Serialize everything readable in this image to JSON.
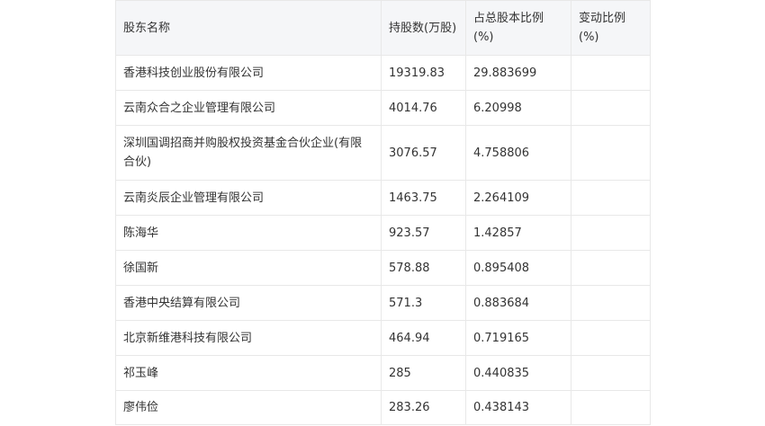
{
  "table": {
    "headers": [
      "股东名称",
      "持股数(万股)",
      "占总股本比例(%)",
      "变动比例(%)"
    ],
    "rows": [
      [
        "香港科技创业股份有限公司",
        "19319.83",
        "29.883699",
        ""
      ],
      [
        "云南众合之企业管理有限公司",
        "4014.76",
        "6.20998",
        ""
      ],
      [
        "深圳国调招商并购股权投资基金合伙企业(有限合伙)",
        "3076.57",
        "4.758806",
        ""
      ],
      [
        "云南炎辰企业管理有限公司",
        "1463.75",
        "2.264109",
        ""
      ],
      [
        "陈海华",
        "923.57",
        "1.42857",
        ""
      ],
      [
        "徐国新",
        "578.88",
        "0.895408",
        ""
      ],
      [
        "香港中央结算有限公司",
        "571.3",
        "0.883684",
        ""
      ],
      [
        "北京新维港科技有限公司",
        "464.94",
        "0.719165",
        ""
      ],
      [
        "祁玉峰",
        "285",
        "0.440835",
        ""
      ],
      [
        "廖伟俭",
        "283.26",
        "0.438143",
        ""
      ]
    ]
  }
}
